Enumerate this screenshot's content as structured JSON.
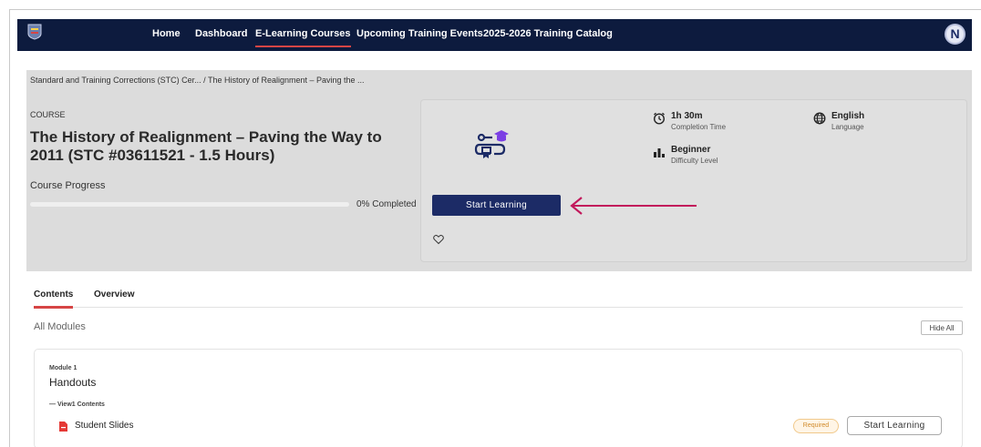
{
  "nav": {
    "items": [
      "Home",
      "Dashboard",
      "E-Learning Courses",
      "Upcoming Training Events",
      "2025-2026 Training Catalog"
    ],
    "avatar_initial": "N"
  },
  "breadcrumb": {
    "parent": "Standard and Training Corrections (STC) Cer...",
    "separator": "/",
    "current": "The History of Realignment – Paving the ..."
  },
  "course": {
    "kicker": "COURSE",
    "title": "The History of Realignment – Paving the Way to 2011 (STC #03611521 - 1.5 Hours)",
    "progress_label": "Course Progress",
    "progress_percent": 0,
    "progress_text": "0% Completed",
    "start_label": "Start Learning",
    "duration_value": "1h 30m",
    "duration_label": "Completion Time",
    "level_value": "Beginner",
    "level_label": "Difficulty Level",
    "language_value": "English",
    "language_label": "Language"
  },
  "icons": {
    "course": "course-certificate-icon",
    "clock": "clock-icon",
    "level": "bar-chart-icon",
    "globe": "globe-icon",
    "heart": "heart-icon",
    "pdf": "pdf-file-icon",
    "arrow": "red-arrow-annotation"
  },
  "colors": {
    "nav_bg": "#0d1b3e",
    "primary": "#1c2b66",
    "accent_red": "#d64545",
    "arrow": "#c2185b",
    "icon_purple": "#7b3fe4"
  },
  "tabs": [
    "Contents",
    "Overview"
  ],
  "modules_header": {
    "label": "All Modules",
    "hide_label": "Hide All"
  },
  "module": {
    "number": "Module 1",
    "name": "Handouts",
    "view_contents": "— View1 Contents",
    "item_name": "Student Slides",
    "required_label": "Required",
    "item_start_label": "Start Learning"
  }
}
